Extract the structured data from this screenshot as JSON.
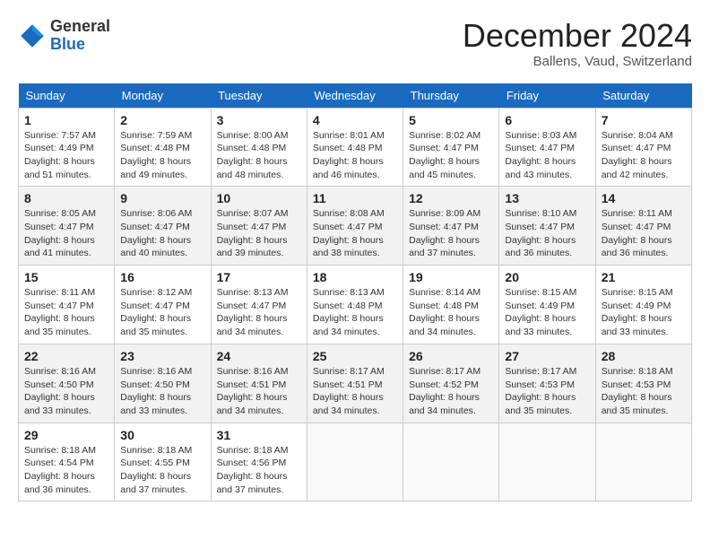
{
  "logo": {
    "line1": "General",
    "line2": "Blue"
  },
  "header": {
    "month": "December 2024",
    "location": "Ballens, Vaud, Switzerland"
  },
  "weekdays": [
    "Sunday",
    "Monday",
    "Tuesday",
    "Wednesday",
    "Thursday",
    "Friday",
    "Saturday"
  ],
  "weeks": [
    [
      {
        "day": "1",
        "sunrise": "7:57 AM",
        "sunset": "4:49 PM",
        "daylight": "8 hours and 51 minutes."
      },
      {
        "day": "2",
        "sunrise": "7:59 AM",
        "sunset": "4:48 PM",
        "daylight": "8 hours and 49 minutes."
      },
      {
        "day": "3",
        "sunrise": "8:00 AM",
        "sunset": "4:48 PM",
        "daylight": "8 hours and 48 minutes."
      },
      {
        "day": "4",
        "sunrise": "8:01 AM",
        "sunset": "4:48 PM",
        "daylight": "8 hours and 46 minutes."
      },
      {
        "day": "5",
        "sunrise": "8:02 AM",
        "sunset": "4:47 PM",
        "daylight": "8 hours and 45 minutes."
      },
      {
        "day": "6",
        "sunrise": "8:03 AM",
        "sunset": "4:47 PM",
        "daylight": "8 hours and 43 minutes."
      },
      {
        "day": "7",
        "sunrise": "8:04 AM",
        "sunset": "4:47 PM",
        "daylight": "8 hours and 42 minutes."
      }
    ],
    [
      {
        "day": "8",
        "sunrise": "8:05 AM",
        "sunset": "4:47 PM",
        "daylight": "8 hours and 41 minutes."
      },
      {
        "day": "9",
        "sunrise": "8:06 AM",
        "sunset": "4:47 PM",
        "daylight": "8 hours and 40 minutes."
      },
      {
        "day": "10",
        "sunrise": "8:07 AM",
        "sunset": "4:47 PM",
        "daylight": "8 hours and 39 minutes."
      },
      {
        "day": "11",
        "sunrise": "8:08 AM",
        "sunset": "4:47 PM",
        "daylight": "8 hours and 38 minutes."
      },
      {
        "day": "12",
        "sunrise": "8:09 AM",
        "sunset": "4:47 PM",
        "daylight": "8 hours and 37 minutes."
      },
      {
        "day": "13",
        "sunrise": "8:10 AM",
        "sunset": "4:47 PM",
        "daylight": "8 hours and 36 minutes."
      },
      {
        "day": "14",
        "sunrise": "8:11 AM",
        "sunset": "4:47 PM",
        "daylight": "8 hours and 36 minutes."
      }
    ],
    [
      {
        "day": "15",
        "sunrise": "8:11 AM",
        "sunset": "4:47 PM",
        "daylight": "8 hours and 35 minutes."
      },
      {
        "day": "16",
        "sunrise": "8:12 AM",
        "sunset": "4:47 PM",
        "daylight": "8 hours and 35 minutes."
      },
      {
        "day": "17",
        "sunrise": "8:13 AM",
        "sunset": "4:47 PM",
        "daylight": "8 hours and 34 minutes."
      },
      {
        "day": "18",
        "sunrise": "8:13 AM",
        "sunset": "4:48 PM",
        "daylight": "8 hours and 34 minutes."
      },
      {
        "day": "19",
        "sunrise": "8:14 AM",
        "sunset": "4:48 PM",
        "daylight": "8 hours and 34 minutes."
      },
      {
        "day": "20",
        "sunrise": "8:15 AM",
        "sunset": "4:49 PM",
        "daylight": "8 hours and 33 minutes."
      },
      {
        "day": "21",
        "sunrise": "8:15 AM",
        "sunset": "4:49 PM",
        "daylight": "8 hours and 33 minutes."
      }
    ],
    [
      {
        "day": "22",
        "sunrise": "8:16 AM",
        "sunset": "4:50 PM",
        "daylight": "8 hours and 33 minutes."
      },
      {
        "day": "23",
        "sunrise": "8:16 AM",
        "sunset": "4:50 PM",
        "daylight": "8 hours and 33 minutes."
      },
      {
        "day": "24",
        "sunrise": "8:16 AM",
        "sunset": "4:51 PM",
        "daylight": "8 hours and 34 minutes."
      },
      {
        "day": "25",
        "sunrise": "8:17 AM",
        "sunset": "4:51 PM",
        "daylight": "8 hours and 34 minutes."
      },
      {
        "day": "26",
        "sunrise": "8:17 AM",
        "sunset": "4:52 PM",
        "daylight": "8 hours and 34 minutes."
      },
      {
        "day": "27",
        "sunrise": "8:17 AM",
        "sunset": "4:53 PM",
        "daylight": "8 hours and 35 minutes."
      },
      {
        "day": "28",
        "sunrise": "8:18 AM",
        "sunset": "4:53 PM",
        "daylight": "8 hours and 35 minutes."
      }
    ],
    [
      {
        "day": "29",
        "sunrise": "8:18 AM",
        "sunset": "4:54 PM",
        "daylight": "8 hours and 36 minutes."
      },
      {
        "day": "30",
        "sunrise": "8:18 AM",
        "sunset": "4:55 PM",
        "daylight": "8 hours and 37 minutes."
      },
      {
        "day": "31",
        "sunrise": "8:18 AM",
        "sunset": "4:56 PM",
        "daylight": "8 hours and 37 minutes."
      },
      null,
      null,
      null,
      null
    ]
  ]
}
